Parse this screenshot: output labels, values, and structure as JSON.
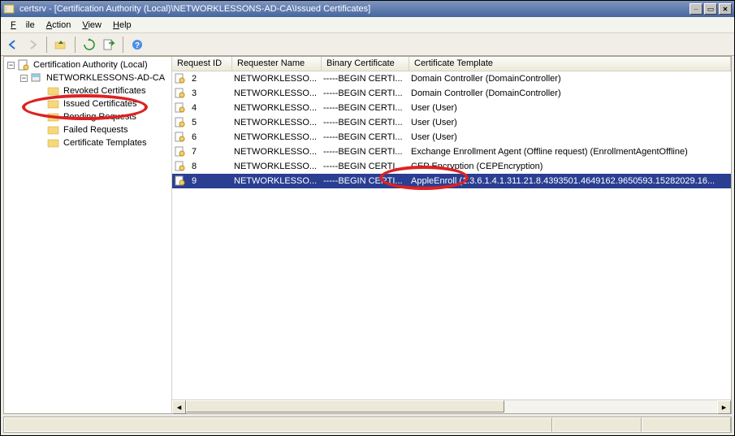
{
  "window": {
    "title": "certsrv - [Certification Authority (Local)\\NETWORKLESSONS-AD-CA\\Issued Certificates]"
  },
  "menu": {
    "file": "File",
    "action": "Action",
    "view": "View",
    "help": "Help"
  },
  "tree": {
    "root": "Certification Authority (Local)",
    "ca": "NETWORKLESSONS-AD-CA",
    "nodes": {
      "revoked": "Revoked Certificates",
      "issued": "Issued Certificates",
      "pending": "Pending Requests",
      "failed": "Failed Requests",
      "templates": "Certificate Templates"
    }
  },
  "columns": {
    "c0": "Request ID",
    "c1": "Requester Name",
    "c2": "Binary Certificate",
    "c3": "Certificate Template"
  },
  "rows": [
    {
      "id": "2",
      "req": "NETWORKLESSO...",
      "bin": "-----BEGIN CERTI...",
      "tpl": "Domain Controller (DomainController)"
    },
    {
      "id": "3",
      "req": "NETWORKLESSO...",
      "bin": "-----BEGIN CERTI...",
      "tpl": "Domain Controller (DomainController)"
    },
    {
      "id": "4",
      "req": "NETWORKLESSO...",
      "bin": "-----BEGIN CERTI...",
      "tpl": "User (User)"
    },
    {
      "id": "5",
      "req": "NETWORKLESSO...",
      "bin": "-----BEGIN CERTI...",
      "tpl": "User (User)"
    },
    {
      "id": "6",
      "req": "NETWORKLESSO...",
      "bin": "-----BEGIN CERTI...",
      "tpl": "User (User)"
    },
    {
      "id": "7",
      "req": "NETWORKLESSO...",
      "bin": "-----BEGIN CERTI...",
      "tpl": "Exchange Enrollment Agent (Offline request) (EnrollmentAgentOffline)"
    },
    {
      "id": "8",
      "req": "NETWORKLESSO...",
      "bin": "-----BEGIN CERTI...",
      "tpl": "CEP Encryption (CEPEncryption)"
    },
    {
      "id": "9",
      "req": "NETWORKLESSO...",
      "bin": "-----BEGIN CERTI...",
      "tpl": "AppleEnroll (1.3.6.1.4.1.311.21.8.4393501.4649162.9650593.15282029.16..."
    }
  ],
  "colwidths": {
    "c0": 74,
    "c1": 110,
    "c2": 108,
    "c3": 390
  }
}
